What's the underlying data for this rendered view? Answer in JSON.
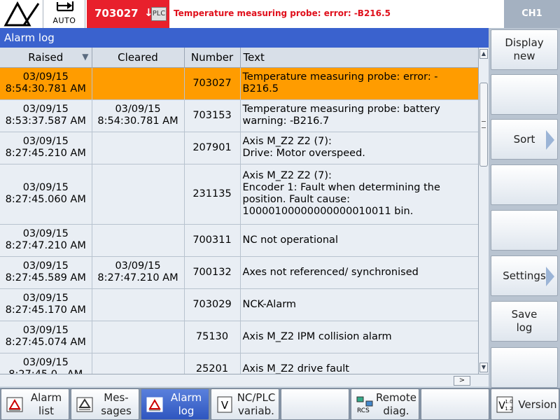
{
  "header": {
    "mode": "AUTO",
    "alarm_number": "703027",
    "alarm_arrow": "↓",
    "plc_badge": "PLC",
    "alarm_message": "Temperature measuring probe: error: -B216.5",
    "channel": "CH1"
  },
  "panel": {
    "title": "Alarm log"
  },
  "table": {
    "columns": [
      "Raised",
      "Cleared",
      "Number",
      "Text"
    ],
    "sort_indicator": "▼",
    "rows": [
      {
        "raised": [
          "03/09/15",
          "8:54:30.781 AM"
        ],
        "cleared": [
          "",
          ""
        ],
        "number": "703027",
        "text": [
          "Temperature measuring probe: error: -",
          "B216.5"
        ],
        "selected": true
      },
      {
        "raised": [
          "03/09/15",
          "8:53:37.587 AM"
        ],
        "cleared": [
          "03/09/15",
          "8:54:30.781 AM"
        ],
        "number": "703153",
        "text": [
          "Temperature measuring probe: battery",
          "warning: -B216.7"
        ],
        "selected": false
      },
      {
        "raised": [
          "03/09/15",
          "8:27:45.210 AM"
        ],
        "cleared": [
          "",
          ""
        ],
        "number": "207901",
        "text": [
          "Axis M_Z2 Z2 (7):",
          "Drive: Motor overspeed."
        ],
        "selected": false
      },
      {
        "raised": [
          "03/09/15",
          "8:27:45.060 AM"
        ],
        "cleared": [
          "",
          ""
        ],
        "number": "231135",
        "text": [
          "Axis M_Z2 Z2 (7):",
          "Encoder 1: Fault when determining the",
          "position. Fault cause:",
          "10000100000000000010011 bin."
        ],
        "selected": false
      },
      {
        "raised": [
          "03/09/15",
          "8:27:47.210 AM"
        ],
        "cleared": [
          "",
          ""
        ],
        "number": "700311",
        "text": [
          "NC not operational"
        ],
        "selected": false
      },
      {
        "raised": [
          "03/09/15",
          "8:27:45.589 AM"
        ],
        "cleared": [
          "03/09/15",
          "8:27:47.210 AM"
        ],
        "number": "700132",
        "text": [
          "Axes not referenced/ synchronised"
        ],
        "selected": false
      },
      {
        "raised": [
          "03/09/15",
          "8:27:45.170 AM"
        ],
        "cleared": [
          "",
          ""
        ],
        "number": "703029",
        "text": [
          "NCK-Alarm"
        ],
        "selected": false
      },
      {
        "raised": [
          "03/09/15",
          "8:27:45.074 AM"
        ],
        "cleared": [
          "",
          ""
        ],
        "number": "75130",
        "text": [
          "Axis M_Z2 IPM collision alarm"
        ],
        "selected": false
      },
      {
        "raised": [
          "03/09/15",
          "8:27:45.0.. AM"
        ],
        "cleared": [
          "",
          ""
        ],
        "number": "25201",
        "text": [
          "Axis M_Z2 drive fault"
        ],
        "selected": false
      }
    ]
  },
  "vertical_softkeys": [
    {
      "label": "Display new",
      "arrow": false
    },
    {
      "label": "",
      "arrow": false
    },
    {
      "label": "Sort",
      "arrow": true
    },
    {
      "label": "",
      "arrow": false
    },
    {
      "label": "",
      "arrow": false
    },
    {
      "label": "Settings",
      "arrow": true
    },
    {
      "label": "Save log",
      "arrow": false
    },
    {
      "label": "",
      "arrow": false
    }
  ],
  "horizontal_softkeys": [
    {
      "label": "Alarm list",
      "icon": "alarm-list-icon",
      "active": false
    },
    {
      "label": "Mes- sages",
      "icon": "messages-icon",
      "active": false
    },
    {
      "label": "Alarm log",
      "icon": "alarm-log-icon",
      "active": true
    },
    {
      "label": "NC/PLC variab.",
      "icon": "variable-icon",
      "active": false
    },
    {
      "label": "",
      "icon": "",
      "active": false
    },
    {
      "label": "Remote diag.",
      "icon": "remote-diag-icon",
      "active": false
    },
    {
      "label": "",
      "icon": "",
      "active": false
    },
    {
      "label": "Version",
      "icon": "version-icon",
      "active": false
    }
  ],
  "colors": {
    "alarm_red": "#e8202c",
    "title_blue": "#3a62ce",
    "selected_orange": "#ff9c00",
    "channel_gray": "#a4b1c1"
  }
}
